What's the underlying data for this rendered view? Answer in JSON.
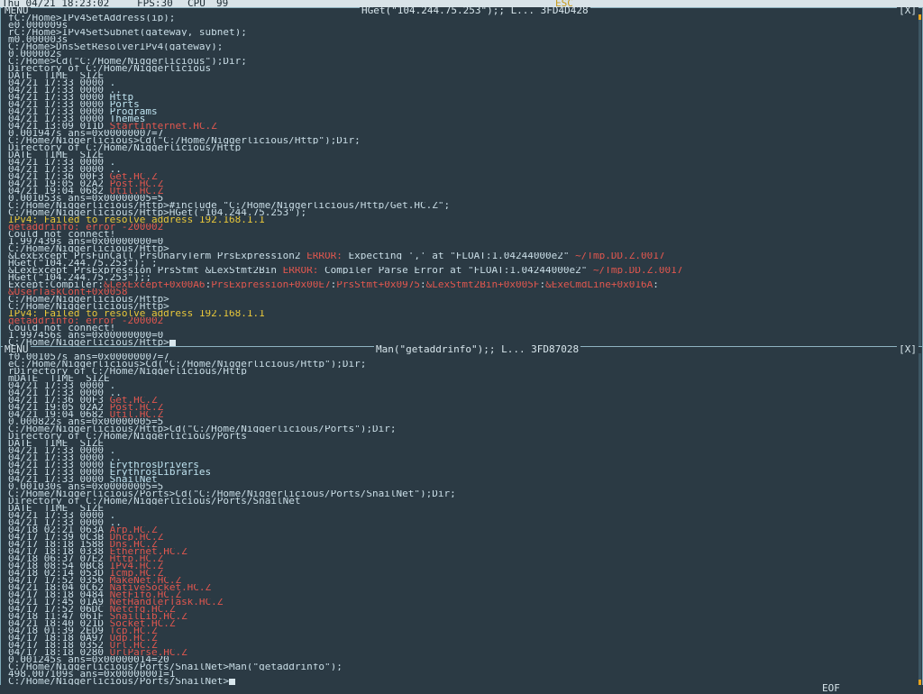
{
  "topbar": {
    "datetime": "Thu 04/21 18:23:02",
    "fps": "FPS:30",
    "cpu": "CPU",
    "cpu_value": "99",
    "esc": "ESC"
  },
  "windows": [
    {
      "menu": "MENU",
      "title": "HGet(\"104.244.75.253\");; L... 3FD4D428",
      "close": "[X]",
      "lines": [
        [
          {
            "t": "fC:/Home>IPv4SetAddress(ip);"
          }
        ],
        [
          {
            "t": "e0.000009s"
          }
        ],
        [
          {
            "t": "rC:/Home>IPv4SetSubnet(gateway, subnet);"
          }
        ],
        [
          {
            "t": "m0.000003s"
          }
        ],
        [
          {
            "t": "C:/Home>DnsSetResolverIPv4(gateway);"
          }
        ],
        [
          {
            "t": "0.000002s"
          }
        ],
        [
          {
            "t": "C:/Home>Cd(\"C:/Home/Niggerlicious\");Dir;"
          }
        ],
        [
          {
            "t": "Directory of C:/Home/Niggerlicious"
          }
        ],
        [
          {
            "t": "DATE_ TIME_ SIZE"
          }
        ],
        [
          {
            "t": "04/21 17:33 0000 "
          },
          {
            "t": ".",
            "c": "tl"
          }
        ],
        [
          {
            "t": "04/21 17:33 0000 "
          },
          {
            "t": "..",
            "c": "tl"
          }
        ],
        [
          {
            "t": "04/21 17:33 0000 "
          },
          {
            "t": "Http",
            "c": "tl"
          }
        ],
        [
          {
            "t": "04/21 17:33 0000 "
          },
          {
            "t": "Ports",
            "c": "tl"
          }
        ],
        [
          {
            "t": "04/21 17:33 0000 "
          },
          {
            "t": "Programs",
            "c": "tl"
          }
        ],
        [
          {
            "t": "04/21 17:33 0000 "
          },
          {
            "t": "Themes",
            "c": "tl"
          }
        ],
        [
          {
            "t": "04/21 13:09 011D "
          },
          {
            "t": "StartInternet.HC.Z",
            "c": "tc"
          }
        ],
        [
          {
            "t": "0.001947s ans=0x00000007=7"
          }
        ],
        [
          {
            "t": "C:/Home/Niggerlicious>Cd(\"C:/Home/Niggerlicious/Http\");Dir;"
          }
        ],
        [
          {
            "t": "Directory of C:/Home/Niggerlicious/Http"
          }
        ],
        [
          {
            "t": "DATE_ TIME_ SIZE"
          }
        ],
        [
          {
            "t": "04/21 17:33 0000 "
          },
          {
            "t": ".",
            "c": "tl"
          }
        ],
        [
          {
            "t": "04/21 17:33 0000 "
          },
          {
            "t": "..",
            "c": "tl"
          }
        ],
        [
          {
            "t": "04/21 17:36 00F3 "
          },
          {
            "t": "Get.HC.Z",
            "c": "tc"
          }
        ],
        [
          {
            "t": "04/21 19:05 02A2 "
          },
          {
            "t": "Post.HC.Z",
            "c": "tc"
          }
        ],
        [
          {
            "t": "04/21 19:04 0682 "
          },
          {
            "t": "Util.HC.Z",
            "c": "tc"
          }
        ],
        [
          {
            "t": "0.001053s ans=0x00000005=5"
          }
        ],
        [
          {
            "t": "C:/Home/Niggerlicious/Http>#include \"C:/Home/Niggerlicious/Http/Get.HC.Z\";"
          }
        ],
        [
          {
            "t": "C:/Home/Niggerlicious/Http>HGet(\"104.244.75.253\");"
          }
        ],
        [
          {
            "t": "IPv4: Failed to resolve address 192.168.1.1",
            "c": "tp"
          }
        ],
        [
          {
            "t": "getaddrinfo: error -200002",
            "c": "tw"
          }
        ],
        [
          {
            "t": "Could not connect!"
          }
        ],
        [
          {
            "t": "1.997439s ans=0x00000000=0"
          }
        ],
        [
          {
            "t": "C:/Home/Niggerlicious/Http>"
          }
        ],
        [
          {
            "t": "&LexExcept PrsFunCall PrsUnaryTerm PrsExpression2 "
          },
          {
            "t": "ERROR:",
            "c": "tw"
          },
          {
            "t": " Expecting ',' at \"FLOAT:1.04244000e2\" "
          },
          {
            "t": "~/Tmp.DD.Z.0017",
            "c": "tc"
          }
        ],
        [
          {
            "t": "HGet(\"104.244.75.253\"); ;"
          }
        ],
        [
          {
            "t": "&LexExcept PrsExpression PrsStmt &LexStmt2Bin "
          },
          {
            "t": "ERROR:",
            "c": "tw"
          },
          {
            "t": " Compiler Parse Error at \"FLOAT:1.04244000e2\" "
          },
          {
            "t": "~/Tmp.DD.Z.0017",
            "c": "tc"
          }
        ],
        [
          {
            "t": "HGet(\"104.244.75.253\");;"
          }
        ],
        [
          {
            "t": "Except:Compiler:"
          },
          {
            "t": "&LexExcept+0x00A6",
            "c": "tc"
          },
          {
            "t": ":"
          },
          {
            "t": "PrsExpression+0x00E7",
            "c": "tc"
          },
          {
            "t": ":"
          },
          {
            "t": "PrsStmt+0x0975",
            "c": "tc"
          },
          {
            "t": ":"
          },
          {
            "t": "&LexStmt2Bin+0x005F",
            "c": "tc"
          },
          {
            "t": ":"
          },
          {
            "t": "&ExeCmdLine+0x016A",
            "c": "tc"
          },
          {
            "t": ":"
          }
        ],
        [
          {
            "t": "&UserTaskCont+0x0058",
            "c": "tc"
          }
        ],
        [
          {
            "t": "C:/Home/Niggerlicious/Http>"
          }
        ],
        [
          {
            "t": "C:/Home/Niggerlicious/Http>"
          }
        ],
        [
          {
            "t": "IPv4: Failed to resolve address 192.168.1.1",
            "c": "tp"
          }
        ],
        [
          {
            "t": "getaddrinfo: error -200002",
            "c": "tw"
          }
        ],
        [
          {
            "t": "Could not connect!"
          }
        ],
        [
          {
            "t": "1.997456s ans=0x00000000=0"
          }
        ],
        [
          {
            "t": "C:/Home/Niggerlicious/Http>"
          },
          {
            "cursor": true
          }
        ]
      ]
    },
    {
      "menu": "MENU",
      "title": "Man(\"getaddrinfo\");; L... 3FD87028",
      "close": "[X]",
      "lines": [
        [
          {
            "t": "f0.001057s ans=0x00000007=7"
          }
        ],
        [
          {
            "t": "eC:/Home/Niggerlicious>Cd(\"C:/Home/Niggerlicious/Http\");Dir;"
          }
        ],
        [
          {
            "t": "rDirectory of C:/Home/Niggerlicious/Http"
          }
        ],
        [
          {
            "t": "mDATE_ TIME_ SIZE"
          }
        ],
        [
          {
            "t": "04/21 17:33 0000 "
          },
          {
            "t": ".",
            "c": "tl"
          }
        ],
        [
          {
            "t": "04/21 17:33 0000 "
          },
          {
            "t": "..",
            "c": "tl"
          }
        ],
        [
          {
            "t": "04/21 17:36 00F3 "
          },
          {
            "t": "Get.HC.Z",
            "c": "tc"
          }
        ],
        [
          {
            "t": "04/21 19:05 02A2 "
          },
          {
            "t": "Post.HC.Z",
            "c": "tc"
          }
        ],
        [
          {
            "t": "04/21 19:04 0682 "
          },
          {
            "t": "Util.HC.Z",
            "c": "tc"
          }
        ],
        [
          {
            "t": "0.000822s ans=0x00000005=5"
          }
        ],
        [
          {
            "t": "C:/Home/Niggerlicious/Http>Cd(\"C:/Home/Niggerlicious/Ports\");Dir;"
          }
        ],
        [
          {
            "t": "Directory of C:/Home/Niggerlicious/Ports"
          }
        ],
        [
          {
            "t": "DATE_ TIME_ SIZE"
          }
        ],
        [
          {
            "t": "04/21 17:33 0000 "
          },
          {
            "t": ".",
            "c": "tl"
          }
        ],
        [
          {
            "t": "04/21 17:33 0000 "
          },
          {
            "t": "..",
            "c": "tl"
          }
        ],
        [
          {
            "t": "04/21 17:33 0000 "
          },
          {
            "t": "ErythrosDrivers",
            "c": "tl"
          }
        ],
        [
          {
            "t": "04/21 17:33 0000 "
          },
          {
            "t": "ErythrosLibraries",
            "c": "tl"
          }
        ],
        [
          {
            "t": "04/21 17:33 0000 "
          },
          {
            "t": "SnailNet",
            "c": "tl"
          }
        ],
        [
          {
            "t": "0.001030s ans=0x00000005=5"
          }
        ],
        [
          {
            "t": "C:/Home/Niggerlicious/Ports>Cd(\"C:/Home/Niggerlicious/Ports/SnailNet\");Dir;"
          }
        ],
        [
          {
            "t": "Directory of C:/Home/Niggerlicious/Ports/SnailNet"
          }
        ],
        [
          {
            "t": "DATE_ TIME_ SIZE"
          }
        ],
        [
          {
            "t": "04/21 17:33 0000 "
          },
          {
            "t": ".",
            "c": "tl"
          }
        ],
        [
          {
            "t": "04/21 17:33 0000 "
          },
          {
            "t": "..",
            "c": "tl"
          }
        ],
        [
          {
            "t": "04/18 02:21 063A "
          },
          {
            "t": "Arp.HC.Z",
            "c": "tc"
          }
        ],
        [
          {
            "t": "04/17 17:39 0C3B "
          },
          {
            "t": "Dhcp.HC.Z",
            "c": "tc"
          }
        ],
        [
          {
            "t": "04/17 18:18 1588 "
          },
          {
            "t": "Dns.HC.Z",
            "c": "tc"
          }
        ],
        [
          {
            "t": "04/17 18:18 0338 "
          },
          {
            "t": "Ethernet.HC.Z",
            "c": "tc"
          }
        ],
        [
          {
            "t": "04/18 06:37 07E2 "
          },
          {
            "t": "Http.HC.Z",
            "c": "tc"
          }
        ],
        [
          {
            "t": "04/18 08:54 0BC8 "
          },
          {
            "t": "IPv4.HC.Z",
            "c": "tc"
          }
        ],
        [
          {
            "t": "04/18 02:14 053D "
          },
          {
            "t": "Icmp.HC.Z",
            "c": "tc"
          }
        ],
        [
          {
            "t": "04/17 17:52 0356 "
          },
          {
            "t": "MakeNet.HC.Z",
            "c": "tc"
          }
        ],
        [
          {
            "t": "04/21 18:04 0C62 "
          },
          {
            "t": "NativeSocket.HC.Z",
            "c": "tc"
          }
        ],
        [
          {
            "t": "04/17 18:18 0484 "
          },
          {
            "t": "NetFifo.HC.Z",
            "c": "tc"
          }
        ],
        [
          {
            "t": "04/21 17:45 01A9 "
          },
          {
            "t": "NetHandlerTask.HC.Z",
            "c": "tc"
          }
        ],
        [
          {
            "t": "04/17 17:52 06DC "
          },
          {
            "t": "Netcfg.HC.Z",
            "c": "tc"
          }
        ],
        [
          {
            "t": "04/18 11:47 061F "
          },
          {
            "t": "SnailLib.HC.Z",
            "c": "tc"
          }
        ],
        [
          {
            "t": "04/21 18:40 021D "
          },
          {
            "t": "Socket.HC.Z",
            "c": "tc"
          }
        ],
        [
          {
            "t": "04/18 01:39 2ED9 "
          },
          {
            "t": "Tcp.HC.Z",
            "c": "tc"
          }
        ],
        [
          {
            "t": "04/17 18:18 0A97 "
          },
          {
            "t": "Udp.HC.Z",
            "c": "tc"
          }
        ],
        [
          {
            "t": "04/17 18:18 0352 "
          },
          {
            "t": "Url.HC.Z",
            "c": "tc"
          }
        ],
        [
          {
            "t": "04/17 18:18 0280 "
          },
          {
            "t": "UrlParse.HC.Z",
            "c": "tc"
          }
        ],
        [
          {
            "t": "0.001245s ans=0x00000014=20"
          }
        ],
        [
          {
            "t": "C:/Home/Niggerlicious/Ports/SnailNet>Man(\"getaddrinfo\");"
          }
        ],
        [
          {
            "t": "498.007109s ans=0x00000001=1"
          }
        ],
        [
          {
            "t": "C:/Home/Niggerlicious/Ports/SnailNet>"
          },
          {
            "cursor": true
          }
        ]
      ]
    }
  ],
  "bottombar": {
    "eof": "EOF"
  }
}
